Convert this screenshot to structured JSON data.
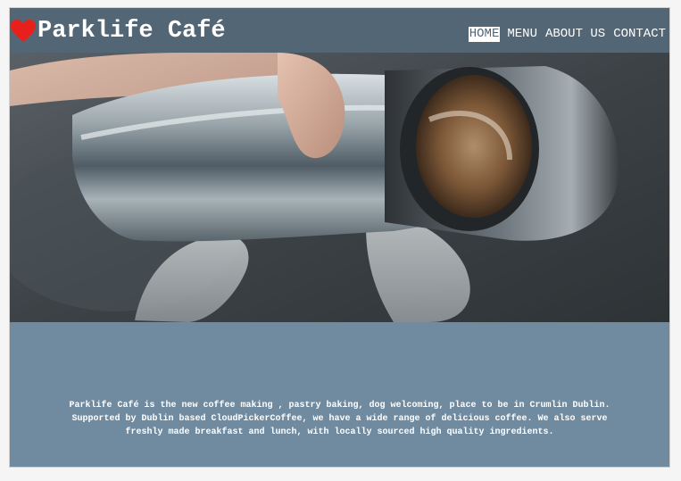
{
  "site": {
    "name": "Parklife Café",
    "logo_icon": "heart-icon",
    "colors": {
      "header": "#536676",
      "body": "#708a9f",
      "heart": "#e8201c",
      "text": "#ffffff"
    }
  },
  "nav": {
    "items": [
      {
        "label": "HOME",
        "active": true
      },
      {
        "label": "MENU",
        "active": false
      },
      {
        "label": "ABOUT US",
        "active": false
      },
      {
        "label": "CONTACT",
        "active": false
      }
    ]
  },
  "hero": {
    "image_subject": "coffee-pour-photo"
  },
  "about": {
    "text": "Parklife Café is the new coffee making , pastry baking, dog welcoming, place to be in Crumlin Dublin. Supported by Dublin based CloudPickerCoffee, we have a wide range of delicious coffee. We also serve freshly made breakfast and lunch, with locally sourced high quality ingredients."
  }
}
